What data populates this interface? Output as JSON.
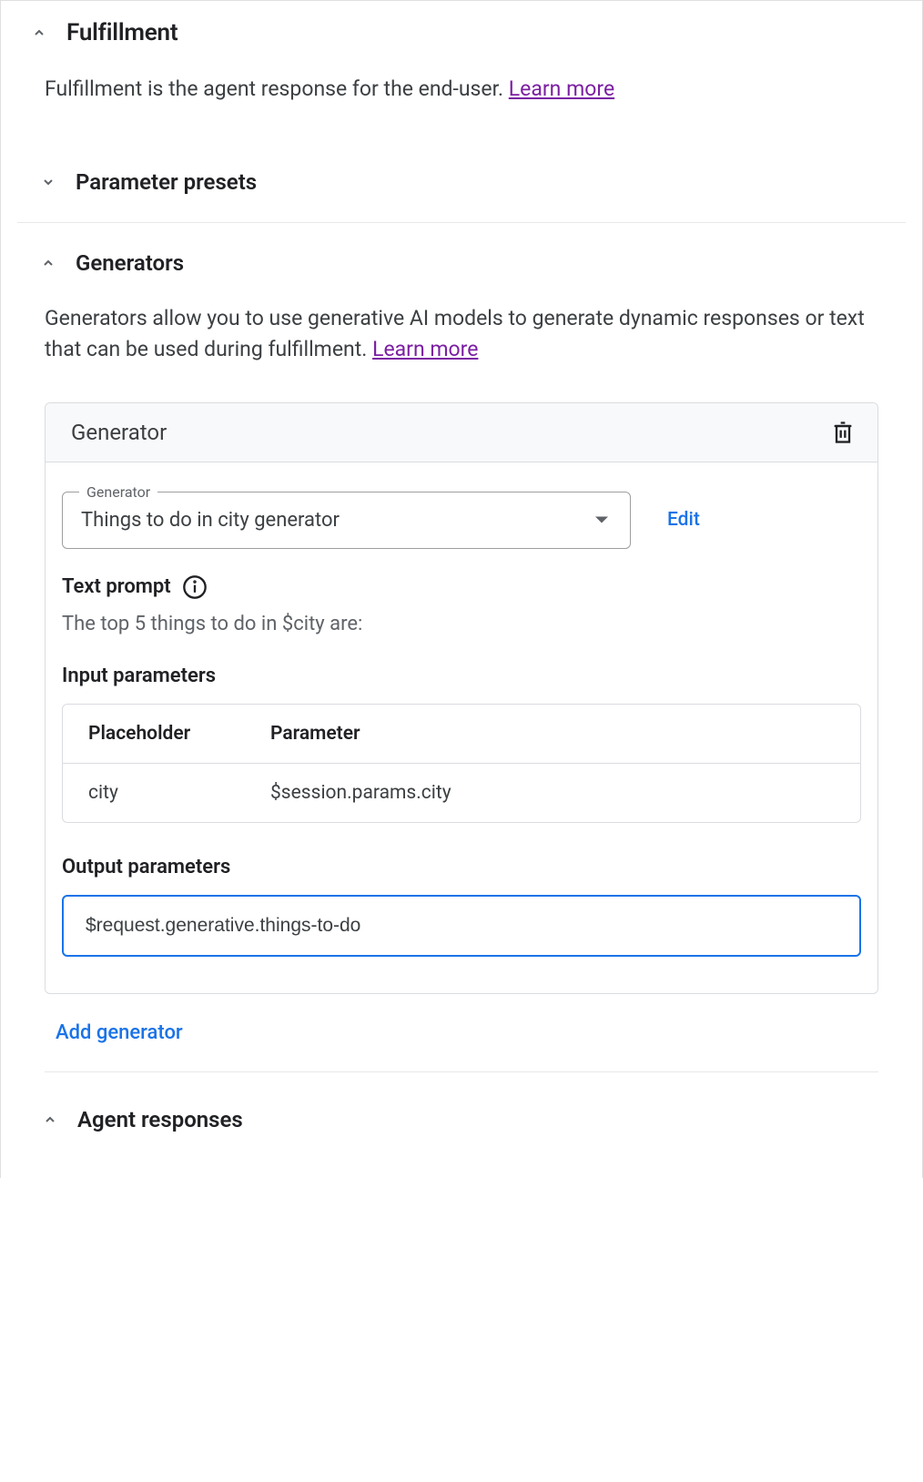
{
  "fulfillment": {
    "title": "Fulfillment",
    "description": "Fulfillment is the agent response for the end-user. ",
    "learn_more": "Learn more"
  },
  "parameter_presets": {
    "title": "Parameter presets"
  },
  "generators": {
    "title": "Generators",
    "description": "Generators allow you to use generative AI models to generate dynamic responses or text that can be used during fulfillment. ",
    "learn_more": "Learn more"
  },
  "generator_card": {
    "header_title": "Generator",
    "select_label": "Generator",
    "select_value": "Things to do in city generator",
    "edit_label": "Edit",
    "text_prompt_label": "Text prompt",
    "text_prompt_value": "The top 5 things to do in $city are:",
    "input_params_label": "Input parameters",
    "input_table": {
      "col1_header": "Placeholder",
      "col2_header": "Parameter",
      "rows": [
        {
          "placeholder": "city",
          "parameter": "$session.params.city"
        }
      ]
    },
    "output_params_label": "Output parameters",
    "output_value": "$request.generative.things-to-do"
  },
  "add_generator_label": "Add generator",
  "agent_responses": {
    "title": "Agent responses"
  }
}
